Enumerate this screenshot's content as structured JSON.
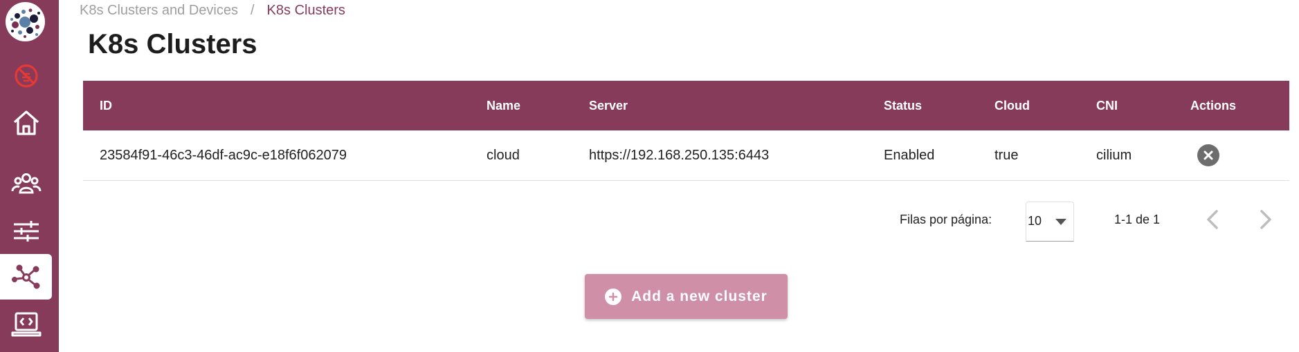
{
  "breadcrumb": {
    "parent": "K8s Clusters and Devices",
    "separator": "/",
    "current": "K8s Clusters"
  },
  "page": {
    "title": "K8s Clusters"
  },
  "sidebar": {
    "items": [
      {
        "name": "logo",
        "icon": "logo-dots-icon"
      },
      {
        "name": "blocked",
        "icon": "no-bug-icon"
      },
      {
        "name": "home",
        "icon": "home-icon"
      },
      {
        "name": "users",
        "icon": "users-group-icon"
      },
      {
        "name": "settings",
        "icon": "sliders-icon"
      },
      {
        "name": "clusters",
        "icon": "network-nodes-icon",
        "active": true
      },
      {
        "name": "devices",
        "icon": "laptop-code-icon"
      }
    ]
  },
  "table": {
    "headers": [
      "ID",
      "Name",
      "Server",
      "Status",
      "Cloud",
      "CNI",
      "Actions"
    ],
    "rows": [
      {
        "id": "23584f91-46c3-46df-ac9c-e18f6f062079",
        "name": "cloud",
        "server": "https://192.168.250.135:6443",
        "status": "Enabled",
        "cloud": "true",
        "cni": "cilium"
      }
    ]
  },
  "pagination": {
    "rows_per_page_label": "Filas por página:",
    "rows_per_page_value": "10",
    "range": "1-1 de 1"
  },
  "actions": {
    "add_label": "Add a new cluster"
  },
  "colors": {
    "brand": "#873b5a",
    "button_disabled": "#cf8fa6",
    "blocked_icon": "#e53935"
  }
}
